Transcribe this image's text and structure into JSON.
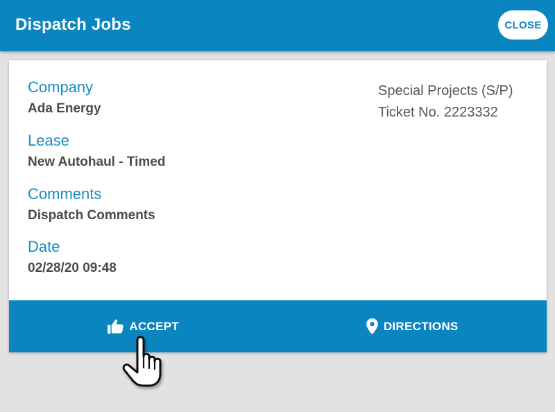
{
  "header": {
    "title": "Dispatch Jobs",
    "close_label": "CLOSE"
  },
  "job": {
    "fields": [
      {
        "label": "Company",
        "value": "Ada Energy"
      },
      {
        "label": "Lease",
        "value": "New Autohaul - Timed"
      },
      {
        "label": "Comments",
        "value": "Dispatch Comments"
      },
      {
        "label": "Date",
        "value": "02/28/20 09:48"
      }
    ],
    "category": "Special Projects (S/P)",
    "ticket": "Ticket No. 2223332"
  },
  "actions": {
    "accept_label": "ACCEPT",
    "accept_icon": "thumbs-up-icon",
    "directions_label": "DIRECTIONS",
    "directions_icon": "map-pin-icon"
  },
  "cursor": {
    "icon": "hand-pointer-cursor"
  },
  "colors": {
    "primary": "#0a85c0",
    "label": "#1a8cc2",
    "value_text": "#4a4a4a",
    "background": "#e2e2e2"
  }
}
